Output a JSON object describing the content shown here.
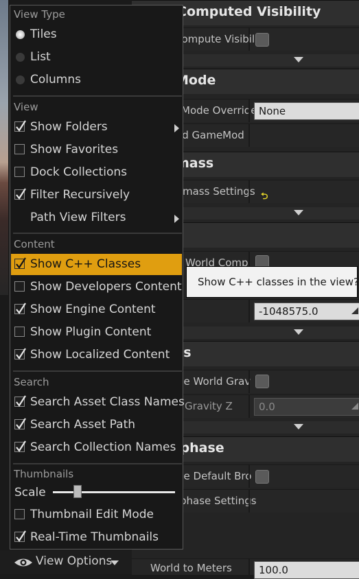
{
  "details": {
    "sections": [
      {
        "title": "Computed Visibility",
        "inset": true,
        "rows": [
          {
            "label": "Compute Visibility",
            "control": "checkbox"
          }
        ]
      },
      {
        "title": "Mode",
        "rows": [
          {
            "label": "Mode Override",
            "control": "dropdown",
            "value": "None"
          },
          {
            "label": "ed GameMod",
            "control": "none"
          }
        ]
      },
      {
        "title": "mass",
        "rows": [
          {
            "label": "mass Settings",
            "control": "reset"
          }
        ]
      },
      {
        "title": "",
        "rows": [
          {
            "label": "World Comp",
            "control": "checkbox"
          },
          {
            "label": "",
            "control": "number",
            "value": "-1048575.0"
          }
        ]
      },
      {
        "title": "cs",
        "rows": [
          {
            "label": "de World Grav",
            "control": "checkbox"
          },
          {
            "label": "Gravity Z",
            "control": "number-dim",
            "value": "0.0"
          }
        ]
      },
      {
        "title": "lphase",
        "rows": [
          {
            "label": "de Default Bro",
            "control": "checkbox"
          },
          {
            "label": "phase Settings",
            "control": "none"
          }
        ]
      }
    ],
    "world_to_meters": {
      "label": "World to Meters",
      "value": "100.0"
    }
  },
  "tooltip": {
    "text": "Show C++ classes in the view?"
  },
  "bottom_bar": {
    "view_options_label": "View Options",
    "icon": "eye-icon"
  },
  "menu": {
    "view_type": {
      "header": "View Type",
      "options": [
        {
          "label": "Tiles",
          "selected": true
        },
        {
          "label": "List",
          "selected": false
        },
        {
          "label": "Columns",
          "selected": false
        }
      ]
    },
    "view": {
      "header": "View",
      "items": [
        {
          "label": "Show Folders",
          "checked": true,
          "submenu": true
        },
        {
          "label": "Show Favorites",
          "checked": false,
          "submenu": false
        },
        {
          "label": "Dock Collections",
          "checked": false,
          "submenu": false
        },
        {
          "label": "Filter Recursively",
          "checked": true,
          "submenu": false
        },
        {
          "label": "Path View Filters",
          "checked": null,
          "submenu": true
        }
      ]
    },
    "content": {
      "header": "Content",
      "items": [
        {
          "label": "Show C++ Classes",
          "checked": true,
          "highlighted": true
        },
        {
          "label": "Show Developers Content",
          "checked": false
        },
        {
          "label": "Show Engine Content",
          "checked": true
        },
        {
          "label": "Show Plugin Content",
          "checked": false
        },
        {
          "label": "Show Localized Content",
          "checked": true
        }
      ]
    },
    "search": {
      "header": "Search",
      "items": [
        {
          "label": "Search Asset Class Names",
          "checked": true
        },
        {
          "label": "Search Asset Path",
          "checked": true
        },
        {
          "label": "Search Collection Names",
          "checked": true
        }
      ]
    },
    "thumbnails": {
      "header": "Thumbnails",
      "scale_label": "Scale",
      "scale_value": 0.2,
      "items": [
        {
          "label": "Thumbnail Edit Mode",
          "checked": false
        },
        {
          "label": "Real-Time Thumbnails",
          "checked": true
        }
      ]
    }
  }
}
